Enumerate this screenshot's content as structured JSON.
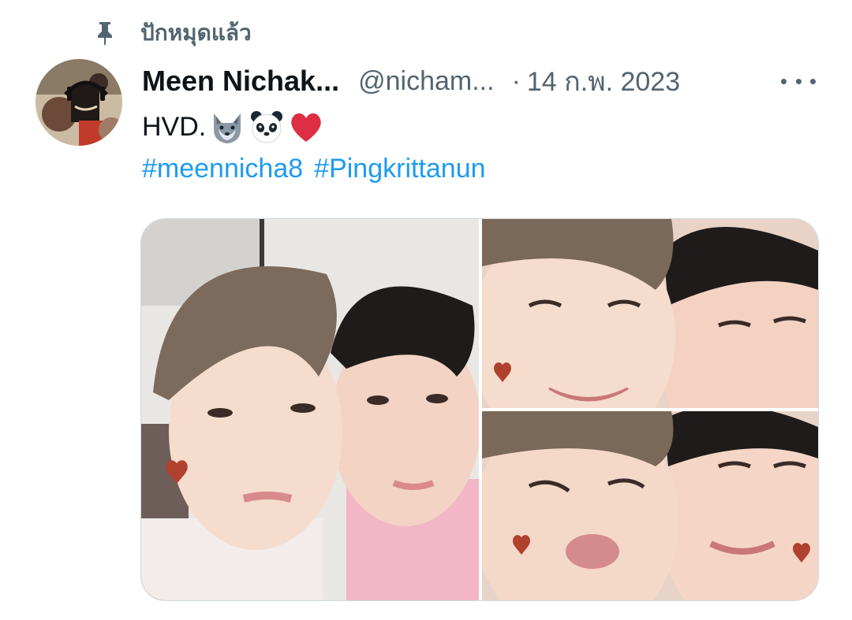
{
  "pinned": {
    "label": "ปักหมุดแล้ว",
    "icon": "pin-icon"
  },
  "author": {
    "display_name": "Meen Nichak...",
    "handle": "@nicham...",
    "separator": "·",
    "date": "14 ก.พ. 2023",
    "avatar_icon": "avatar-image"
  },
  "tweet": {
    "text": "HVD.",
    "emojis": [
      "wolf-emoji",
      "panda-emoji",
      "red-heart-emoji"
    ],
    "hashtags": [
      "#meennicha8",
      "#Pingkrittanun"
    ]
  },
  "media": {
    "photos": [
      "photo-1",
      "photo-2",
      "photo-3"
    ]
  },
  "colors": {
    "text_primary": "#0f1419",
    "text_secondary": "#536471",
    "link": "#1d9bf0",
    "border": "#cfd9de"
  }
}
